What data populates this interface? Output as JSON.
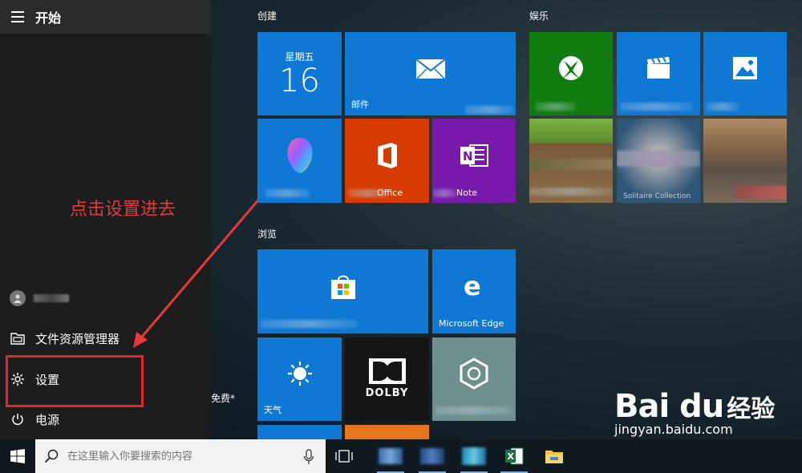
{
  "start_menu": {
    "title": "开始",
    "user_name": "",
    "items": [
      {
        "label": "文件资源管理器"
      },
      {
        "label": "设置"
      },
      {
        "label": "电源"
      }
    ]
  },
  "annotation": "点击设置进去",
  "groups": {
    "create": "创建",
    "entertainment": "娱乐",
    "browse": "浏览"
  },
  "tiles": {
    "calendar": {
      "weekday": "星期五",
      "day": "16"
    },
    "mail": {
      "label": "邮件"
    },
    "paint3d": {
      "label": ""
    },
    "office": {
      "label": "Office"
    },
    "onenote": {
      "label": "Note"
    },
    "xbox": {
      "label": "Xbox"
    },
    "movies": {
      "label": "电影和电视"
    },
    "photos": {
      "label": "照片"
    },
    "minecraft": {
      "label": ""
    },
    "solitaire": {
      "label": "Solitaire Collection"
    },
    "age_of_empires": {
      "label": ""
    },
    "store": {
      "label": ""
    },
    "edge": {
      "label": "Microsoft Edge"
    },
    "weather": {
      "label": "天气"
    },
    "dolby": {
      "label": "DOLBY"
    },
    "drawboard": {
      "label": ""
    }
  },
  "free_label": "免费*",
  "taskbar": {
    "search_placeholder": "在这里输入你要搜索的内容"
  },
  "watermark": {
    "brand": "Bai du",
    "jingyan": "经验",
    "url": "jingyan.baidu.com"
  }
}
